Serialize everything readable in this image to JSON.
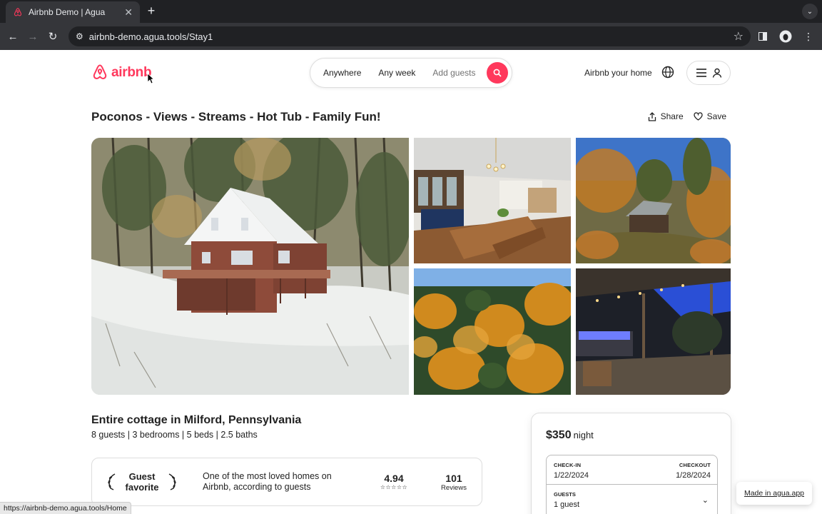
{
  "browser": {
    "tab_title": "Airbnb Demo | Agua",
    "tab_close": "✕",
    "new_tab": "+",
    "url": "airbnb-demo.agua.tools/Stay1",
    "status_url": "https://airbnb-demo.agua.tools/Home"
  },
  "header": {
    "logo_text": "airbnb",
    "search": {
      "where": "Anywhere",
      "when": "Any week",
      "who": "Add guests"
    },
    "host_link": "Airbnb your home"
  },
  "listing": {
    "title": "Poconos - Views - Streams - Hot Tub - Family Fun!",
    "share_label": "Share",
    "save_label": "Save",
    "subtitle": "Entire cottage in Milford, Pennsylvania",
    "details": "8 guests | 3 bedrooms | 5 beds | 2.5 baths",
    "photos": [
      "exterior-snow",
      "dining-room",
      "cabin-autumn",
      "autumn-forest",
      "hot-tub-night"
    ]
  },
  "guest_favorite": {
    "badge": "Guest favorite",
    "description": "One of the most loved homes on Airbnb, according to guests",
    "rating": "4.94",
    "stars": "☆☆☆☆☆",
    "reviews_count": "101",
    "reviews_label": "Reviews"
  },
  "booking": {
    "price": "$350",
    "price_unit": "night",
    "checkin_label": "CHECK-IN",
    "checkin_value": "1/22/2024",
    "checkout_label": "CHECKOUT",
    "checkout_value": "1/28/2024",
    "guests_label": "GUESTS",
    "guests_value": "1 guest"
  },
  "made_in": "Made in agua.app",
  "colors": {
    "brand": "#ff385c",
    "text": "#222222"
  }
}
